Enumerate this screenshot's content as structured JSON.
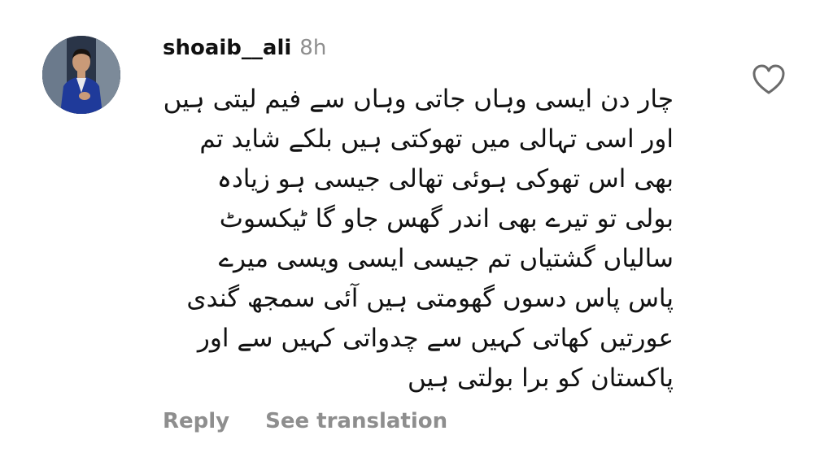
{
  "comment": {
    "username": "shoaib__ali",
    "timestamp": "8h",
    "body_lines": [
      "چار دن ایسی وہاں جاتی وہاں سے فیم لیتی ہیں",
      "اور  اسی تہالی میں تھوکتی ہیں بلکے شاید تم",
      "بھی اس تھوکی ہوئی تھالی جیسی ہو زیادہ",
      "بولی تو تیرے بھی اندر گھس جاو گا ٹیکسوٹ",
      "سالیاں گشتیاں تم جیسی ایسی ویسی میرے",
      "پاس پاس دسوں گھومتی ہیں آئی سمجھ گندی",
      "عورتیں کھاتی کہیں سے چدواتی کہیں سے اور",
      "پاکستان کو برا بولتی ہیں"
    ],
    "actions": {
      "reply_label": "Reply",
      "translate_label": "See translation"
    },
    "icons": {
      "like": "heart-outline-icon",
      "avatar": "profile-photo"
    }
  }
}
